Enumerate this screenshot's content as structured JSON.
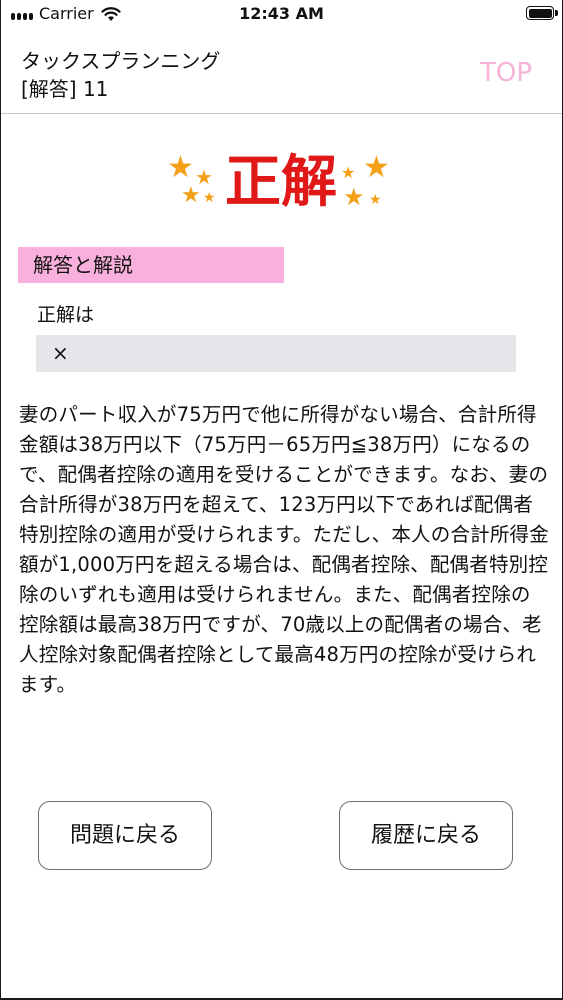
{
  "status_bar": {
    "carrier": "Carrier",
    "time": "12:43 AM",
    "battery_percent": 100
  },
  "header": {
    "app_title": "タックスプランニング",
    "question_id": "[解答] 11",
    "top_link": "TOP",
    "top_link_color": "#f6b3d6"
  },
  "result": {
    "label": "正解",
    "label_color": "#e01818",
    "star_color": "#f4a018"
  },
  "section": {
    "heading": "解答と解説",
    "heading_color": "#f9b0dc",
    "answer_label": "正解は",
    "answer_value": "×",
    "explanation": "妻のパート収入が75万円で他に所得がない場合、合計所得金額は38万円以下（75万円－65万円≦38万円）になるので、配偶者控除の適用を受けることができます。なお、妻の合計所得が38万円を超えて、123万円以下であれば配偶者特別控除の適用が受けられます。ただし、本人の合計所得金額が1,000万円を超える場合は、配偶者控除、配偶者特別控除のいずれも適用は受けられません。また、配偶者控除の控除額は最高38万円ですが、70歳以上の配偶者の場合、老人控除対象配偶者控除として最高48万円の控除が受けられます。"
  },
  "buttons": {
    "back_to_question": "問題に戻る",
    "back_to_history": "履歴に戻る"
  }
}
